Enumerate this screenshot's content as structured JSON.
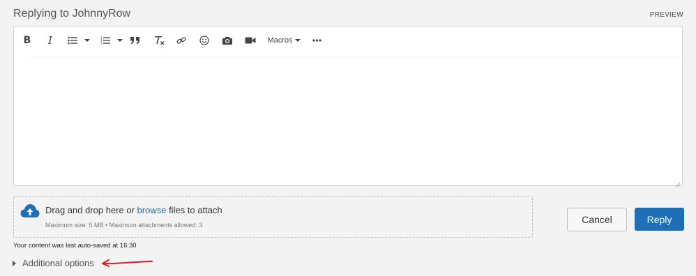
{
  "header": {
    "title": "Replying to JohnnyRow",
    "preview_label": "PREVIEW"
  },
  "toolbar": {
    "bold_label": "B",
    "italic_label": "I",
    "macros_label": "Macros",
    "icons": [
      "bold-icon",
      "italic-icon",
      "bullet-list-icon",
      "numbered-list-icon",
      "quote-icon",
      "clear-format-icon",
      "link-icon",
      "emoji-icon",
      "camera-icon",
      "video-icon",
      "more-icon"
    ]
  },
  "editor": {
    "content": ""
  },
  "dropzone": {
    "text_before": "Drag and drop here or ",
    "browse_label": "browse",
    "text_after": " files to attach",
    "limits": "Maximum size: 5 MB • Maximum attachments allowed: 3"
  },
  "actions": {
    "cancel_label": "Cancel",
    "reply_label": "Reply"
  },
  "status": {
    "autosave_text": "Your content was last auto-saved at 16:30"
  },
  "options": {
    "additional_label": "Additional options"
  },
  "colors": {
    "accent": "#1f6fb7",
    "link": "#1f72b8",
    "annotation": "#d62020"
  }
}
